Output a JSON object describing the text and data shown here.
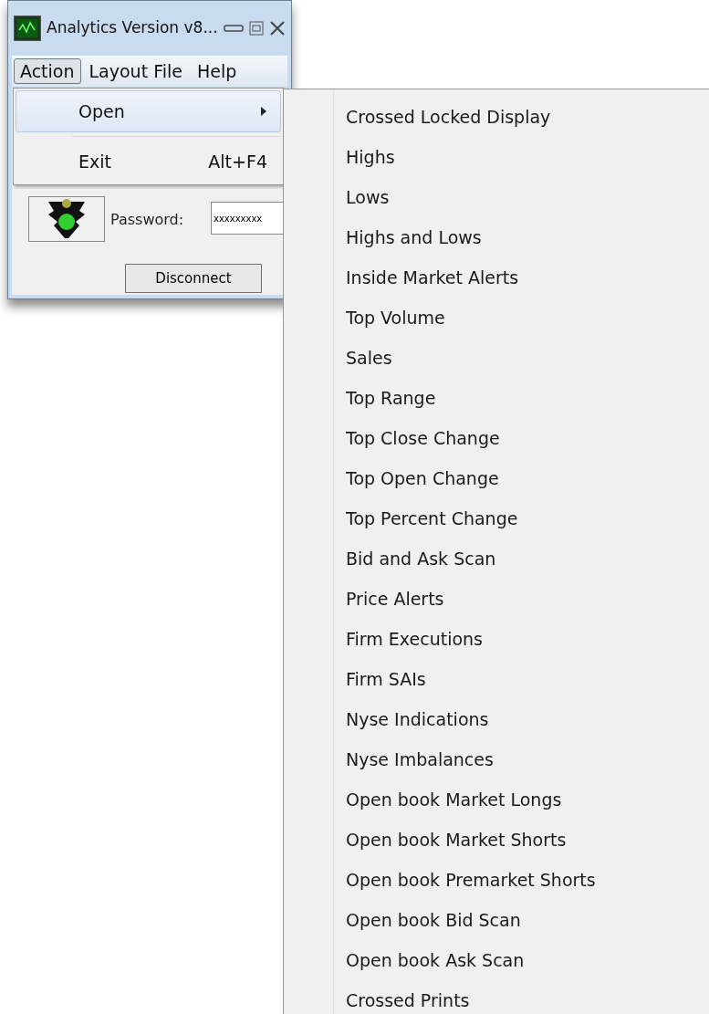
{
  "window": {
    "title": "Analytics Version v8..."
  },
  "menu_bar": [
    {
      "label": "Action",
      "selected": true
    },
    {
      "label": "Layout File",
      "selected": false
    },
    {
      "label": "Help",
      "selected": false
    }
  ],
  "dropdown": [
    {
      "kind": "submenu",
      "label": "Open",
      "selected": true
    },
    {
      "kind": "command",
      "label": "Exit",
      "shortcut": "Alt+F4",
      "selected": false
    }
  ],
  "password": {
    "label": "Password:",
    "value": "xxxxxxxxx"
  },
  "disconnect_button": "Disconnect",
  "submenu": [
    "Crossed Locked Display",
    "Highs",
    "Lows",
    "Highs and Lows",
    "Inside Market Alerts",
    "Top Volume",
    "Sales",
    "Top Range",
    "Top Close Change",
    "Top Open Change",
    "Top Percent Change",
    "Bid and Ask Scan",
    "Price Alerts",
    "Firm Executions",
    "Firm SAIs",
    "Nyse Indications",
    "Nyse Imbalances",
    "Open book Market Longs",
    "Open book Market Shorts",
    "Open book Premarket Shorts",
    "Open book Bid Scan",
    "Open book Ask Scan",
    "Crossed Prints"
  ]
}
